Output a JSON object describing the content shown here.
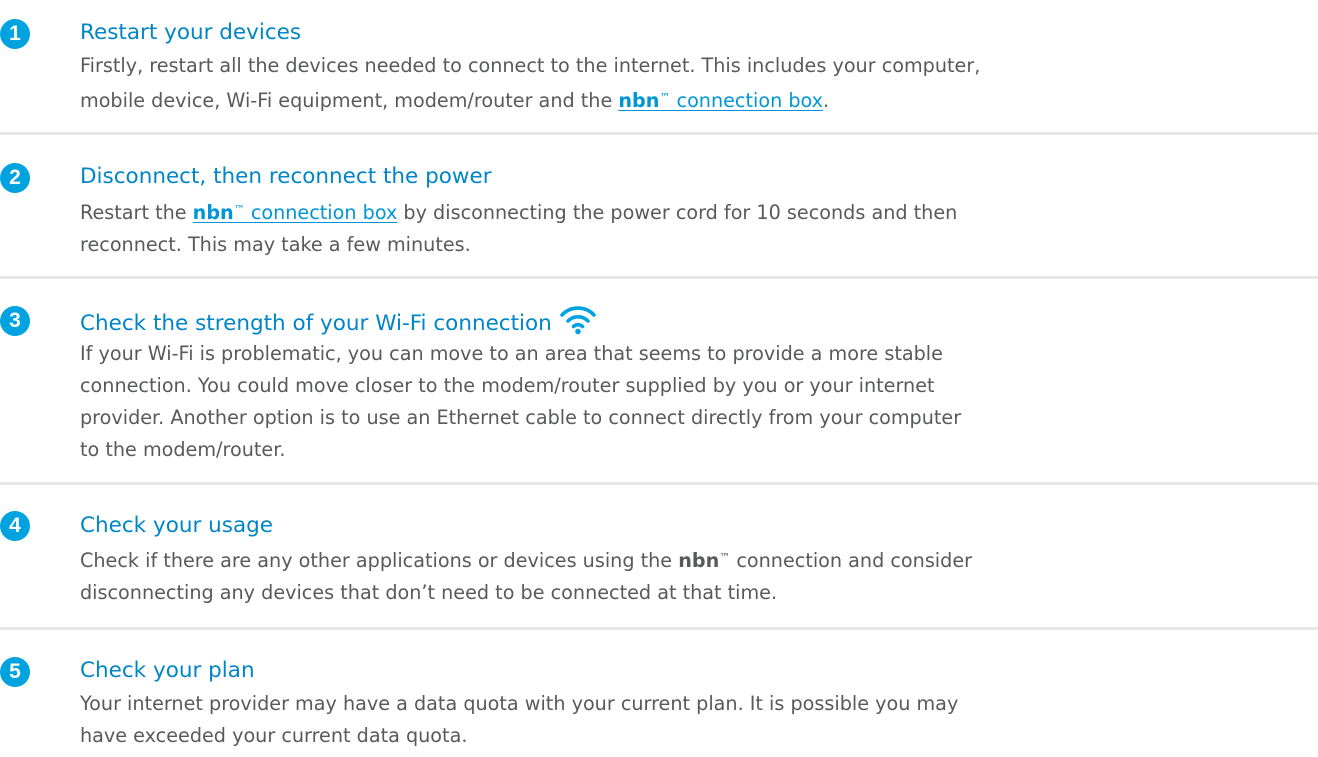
{
  "colors": {
    "accent": "#00a3e0",
    "title": "#0086c8",
    "link": "#0096d6",
    "body_text": "#58595b",
    "divider": "#e6e7e8"
  },
  "steps": [
    {
      "number": "1",
      "title": "Restart your devices",
      "lines": [
        "Firstly, restart all the devices needed to connect to the internet. This includes your computer,",
        "mobile device, Wi-Fi equipment, modem/router and the "
      ],
      "link": {
        "brand": "nbn",
        "trademark": "™",
        "text": " connection box"
      },
      "trailing": "."
    },
    {
      "number": "2",
      "title": "Disconnect, then reconnect the power",
      "lead": "Restart the ",
      "link": {
        "brand": "nbn",
        "trademark": "™",
        "text": " connection box"
      },
      "lines": [
        " by disconnecting the power cord for 10 seconds and then",
        "reconnect. This may take a few minutes."
      ]
    },
    {
      "number": "3",
      "title": "Check the strength of your Wi-Fi connection",
      "icon": "wifi-icon",
      "lines": [
        "If your Wi-Fi is problematic, you can move to an area that seems to provide a more stable",
        "connection. You could move closer to the modem/router supplied by you or your internet",
        "provider. Another option is to use an Ethernet cable to connect directly from your computer",
        "to the modem/router."
      ]
    },
    {
      "number": "4",
      "title": "Check your usage",
      "lines": [
        "Check if there are any other applications or devices using the ",
        " connection and consider",
        "disconnecting any devices that don’t need to be connected at that time."
      ],
      "brand": "nbn",
      "trademark": "™"
    },
    {
      "number": "5",
      "title": "Check your plan",
      "lines": [
        "Your internet provider may have a data quota with your current plan. It is possible you may",
        "have exceeded your current data quota."
      ]
    }
  ]
}
